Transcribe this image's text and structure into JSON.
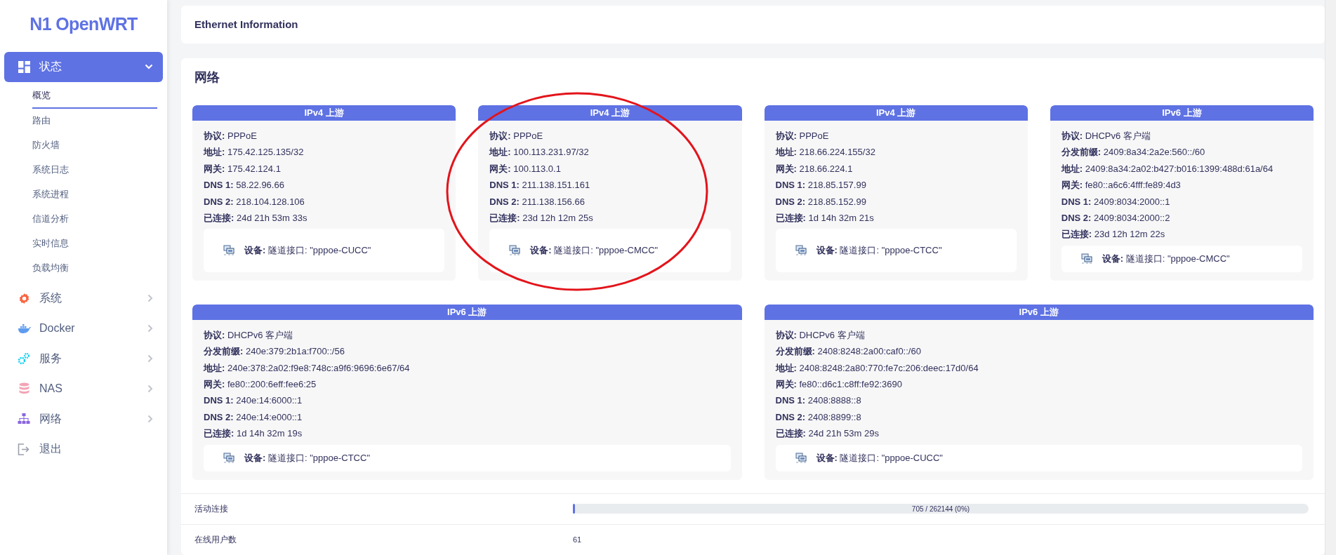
{
  "logo": "N1 OpenWRT",
  "menu": [
    {
      "label": "状态",
      "kind": "group",
      "expanded": true,
      "selected": true,
      "children": [
        {
          "label": "概览",
          "selected": true
        },
        {
          "label": "路由",
          "selected": false
        },
        {
          "label": "防火墙",
          "selected": false
        },
        {
          "label": "系统日志",
          "selected": false
        },
        {
          "label": "系统进程",
          "selected": false
        },
        {
          "label": "信道分析",
          "selected": false
        },
        {
          "label": "实时信息",
          "selected": false
        },
        {
          "label": "负载均衡",
          "selected": false
        }
      ]
    },
    {
      "label": "系统",
      "kind": "group",
      "expanded": false,
      "selected": false
    },
    {
      "label": "Docker",
      "kind": "group",
      "expanded": false,
      "selected": false
    },
    {
      "label": "服务",
      "kind": "group",
      "expanded": false,
      "selected": false
    },
    {
      "label": "NAS",
      "kind": "group",
      "expanded": false,
      "selected": false
    },
    {
      "label": "网络",
      "kind": "group",
      "expanded": false,
      "selected": false
    },
    {
      "label": "退出",
      "kind": "action",
      "selected": false
    }
  ],
  "header_card": {
    "title": "Ethernet Information"
  },
  "network": {
    "title": "网络",
    "upstream_rows": [
      [
        {
          "title": "IPv4 上游",
          "fields": [
            {
              "label": "协议:",
              "value": "PPPoE"
            },
            {
              "label": "地址:",
              "value": "175.42.125.135/32"
            },
            {
              "label": "网关:",
              "value": "175.42.124.1"
            },
            {
              "label": "DNS 1:",
              "value": "58.22.96.66"
            },
            {
              "label": "DNS 2:",
              "value": "218.104.128.106"
            },
            {
              "label": "已连接:",
              "value": "24d 21h 53m 33s"
            }
          ],
          "device": {
            "label": "设备:",
            "value": "隧道接口: \"pppoe-CUCC\""
          }
        },
        {
          "title": "IPv4 上游",
          "fields": [
            {
              "label": "协议:",
              "value": "PPPoE"
            },
            {
              "label": "地址:",
              "value": "100.113.231.97/32"
            },
            {
              "label": "网关:",
              "value": "100.113.0.1"
            },
            {
              "label": "DNS 1:",
              "value": "211.138.151.161"
            },
            {
              "label": "DNS 2:",
              "value": "211.138.156.66"
            },
            {
              "label": "已连接:",
              "value": "23d 12h 12m 25s"
            }
          ],
          "device": {
            "label": "设备:",
            "value": "隧道接口: \"pppoe-CMCC\""
          }
        },
        {
          "title": "IPv4 上游",
          "fields": [
            {
              "label": "协议:",
              "value": "PPPoE"
            },
            {
              "label": "地址:",
              "value": "218.66.224.155/32"
            },
            {
              "label": "网关:",
              "value": "218.66.224.1"
            },
            {
              "label": "DNS 1:",
              "value": "218.85.157.99"
            },
            {
              "label": "DNS 2:",
              "value": "218.85.152.99"
            },
            {
              "label": "已连接:",
              "value": "1d 14h 32m 21s"
            }
          ],
          "device": {
            "label": "设备:",
            "value": "隧道接口: \"pppoe-CTCC\""
          }
        },
        {
          "title": "IPv6 上游",
          "fields": [
            {
              "label": "协议:",
              "value": "DHCPv6 客户端"
            },
            {
              "label": "分发前缀:",
              "value": "2409:8a34:2a2e:560::/60"
            },
            {
              "label": "地址:",
              "value": "2409:8a34:2a02:b427:b016:1399:488d:61a/64"
            },
            {
              "label": "网关:",
              "value": "fe80::a6c6:4fff:fe89:4d3"
            },
            {
              "label": "DNS 1:",
              "value": "2409:8034:2000::1"
            },
            {
              "label": "DNS 2:",
              "value": "2409:8034:2000::2"
            },
            {
              "label": "已连接:",
              "value": "23d 12h 12m 22s"
            }
          ],
          "device": {
            "label": "设备:",
            "value": "隧道接口: \"pppoe-CMCC\""
          }
        }
      ],
      [
        {
          "title": "IPv6 上游",
          "fields": [
            {
              "label": "协议:",
              "value": "DHCPv6 客户端"
            },
            {
              "label": "分发前缀:",
              "value": "240e:379:2b1a:f700::/56"
            },
            {
              "label": "地址:",
              "value": "240e:378:2a02:f9e8:748c:a9f6:9696:6e67/64"
            },
            {
              "label": "网关:",
              "value": "fe80::200:6eff:fee6:25"
            },
            {
              "label": "DNS 1:",
              "value": "240e:14:6000::1"
            },
            {
              "label": "DNS 2:",
              "value": "240e:14:e000::1"
            },
            {
              "label": "已连接:",
              "value": "1d 14h 32m 19s"
            }
          ],
          "device": {
            "label": "设备:",
            "value": "隧道接口: \"pppoe-CTCC\""
          }
        },
        {
          "title": "IPv6 上游",
          "fields": [
            {
              "label": "协议:",
              "value": "DHCPv6 客户端"
            },
            {
              "label": "分发前缀:",
              "value": "2408:8248:2a00:caf0::/60"
            },
            {
              "label": "地址:",
              "value": "2408:8248:2a80:770:fe7c:206:deec:17d0/64"
            },
            {
              "label": "网关:",
              "value": "fe80::d6c1:c8ff:fe92:3690"
            },
            {
              "label": "DNS 1:",
              "value": "2408:8888::8"
            },
            {
              "label": "DNS 2:",
              "value": "2408:8899::8"
            },
            {
              "label": "已连接:",
              "value": "24d 21h 53m 29s"
            }
          ],
          "device": {
            "label": "设备:",
            "value": "隧道接口: \"pppoe-CUCC\""
          }
        }
      ]
    ],
    "status_rows": [
      {
        "label": "活动连接",
        "kind": "progress",
        "level": 0.003,
        "reading": "705 / 262144 (0%)"
      },
      {
        "label": "在线用户数",
        "kind": "text",
        "value": "61"
      }
    ]
  }
}
